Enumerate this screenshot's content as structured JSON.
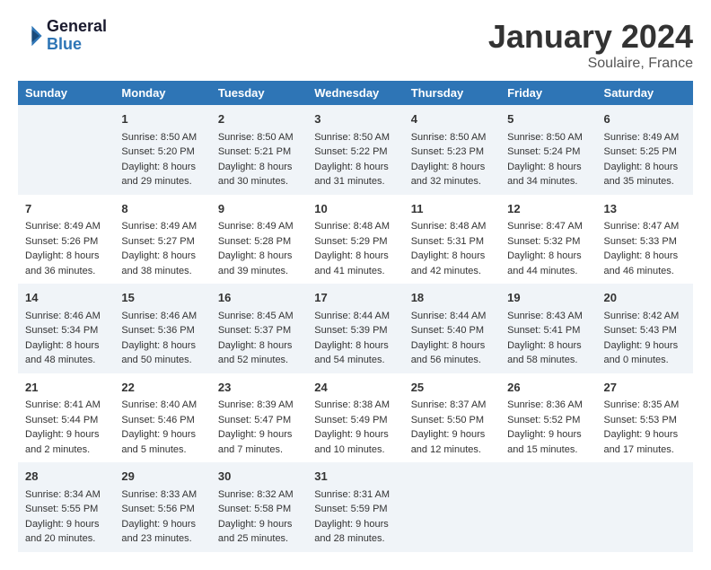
{
  "header": {
    "logo_general": "General",
    "logo_blue": "Blue",
    "month_title": "January 2024",
    "location": "Soulaire, France"
  },
  "days_of_week": [
    "Sunday",
    "Monday",
    "Tuesday",
    "Wednesday",
    "Thursday",
    "Friday",
    "Saturday"
  ],
  "weeks": [
    [
      {
        "day": "",
        "sunrise": "",
        "sunset": "",
        "daylight": ""
      },
      {
        "day": "1",
        "sunrise": "Sunrise: 8:50 AM",
        "sunset": "Sunset: 5:20 PM",
        "daylight": "Daylight: 8 hours and 29 minutes."
      },
      {
        "day": "2",
        "sunrise": "Sunrise: 8:50 AM",
        "sunset": "Sunset: 5:21 PM",
        "daylight": "Daylight: 8 hours and 30 minutes."
      },
      {
        "day": "3",
        "sunrise": "Sunrise: 8:50 AM",
        "sunset": "Sunset: 5:22 PM",
        "daylight": "Daylight: 8 hours and 31 minutes."
      },
      {
        "day": "4",
        "sunrise": "Sunrise: 8:50 AM",
        "sunset": "Sunset: 5:23 PM",
        "daylight": "Daylight: 8 hours and 32 minutes."
      },
      {
        "day": "5",
        "sunrise": "Sunrise: 8:50 AM",
        "sunset": "Sunset: 5:24 PM",
        "daylight": "Daylight: 8 hours and 34 minutes."
      },
      {
        "day": "6",
        "sunrise": "Sunrise: 8:49 AM",
        "sunset": "Sunset: 5:25 PM",
        "daylight": "Daylight: 8 hours and 35 minutes."
      }
    ],
    [
      {
        "day": "7",
        "sunrise": "Sunrise: 8:49 AM",
        "sunset": "Sunset: 5:26 PM",
        "daylight": "Daylight: 8 hours and 36 minutes."
      },
      {
        "day": "8",
        "sunrise": "Sunrise: 8:49 AM",
        "sunset": "Sunset: 5:27 PM",
        "daylight": "Daylight: 8 hours and 38 minutes."
      },
      {
        "day": "9",
        "sunrise": "Sunrise: 8:49 AM",
        "sunset": "Sunset: 5:28 PM",
        "daylight": "Daylight: 8 hours and 39 minutes."
      },
      {
        "day": "10",
        "sunrise": "Sunrise: 8:48 AM",
        "sunset": "Sunset: 5:29 PM",
        "daylight": "Daylight: 8 hours and 41 minutes."
      },
      {
        "day": "11",
        "sunrise": "Sunrise: 8:48 AM",
        "sunset": "Sunset: 5:31 PM",
        "daylight": "Daylight: 8 hours and 42 minutes."
      },
      {
        "day": "12",
        "sunrise": "Sunrise: 8:47 AM",
        "sunset": "Sunset: 5:32 PM",
        "daylight": "Daylight: 8 hours and 44 minutes."
      },
      {
        "day": "13",
        "sunrise": "Sunrise: 8:47 AM",
        "sunset": "Sunset: 5:33 PM",
        "daylight": "Daylight: 8 hours and 46 minutes."
      }
    ],
    [
      {
        "day": "14",
        "sunrise": "Sunrise: 8:46 AM",
        "sunset": "Sunset: 5:34 PM",
        "daylight": "Daylight: 8 hours and 48 minutes."
      },
      {
        "day": "15",
        "sunrise": "Sunrise: 8:46 AM",
        "sunset": "Sunset: 5:36 PM",
        "daylight": "Daylight: 8 hours and 50 minutes."
      },
      {
        "day": "16",
        "sunrise": "Sunrise: 8:45 AM",
        "sunset": "Sunset: 5:37 PM",
        "daylight": "Daylight: 8 hours and 52 minutes."
      },
      {
        "day": "17",
        "sunrise": "Sunrise: 8:44 AM",
        "sunset": "Sunset: 5:39 PM",
        "daylight": "Daylight: 8 hours and 54 minutes."
      },
      {
        "day": "18",
        "sunrise": "Sunrise: 8:44 AM",
        "sunset": "Sunset: 5:40 PM",
        "daylight": "Daylight: 8 hours and 56 minutes."
      },
      {
        "day": "19",
        "sunrise": "Sunrise: 8:43 AM",
        "sunset": "Sunset: 5:41 PM",
        "daylight": "Daylight: 8 hours and 58 minutes."
      },
      {
        "day": "20",
        "sunrise": "Sunrise: 8:42 AM",
        "sunset": "Sunset: 5:43 PM",
        "daylight": "Daylight: 9 hours and 0 minutes."
      }
    ],
    [
      {
        "day": "21",
        "sunrise": "Sunrise: 8:41 AM",
        "sunset": "Sunset: 5:44 PM",
        "daylight": "Daylight: 9 hours and 2 minutes."
      },
      {
        "day": "22",
        "sunrise": "Sunrise: 8:40 AM",
        "sunset": "Sunset: 5:46 PM",
        "daylight": "Daylight: 9 hours and 5 minutes."
      },
      {
        "day": "23",
        "sunrise": "Sunrise: 8:39 AM",
        "sunset": "Sunset: 5:47 PM",
        "daylight": "Daylight: 9 hours and 7 minutes."
      },
      {
        "day": "24",
        "sunrise": "Sunrise: 8:38 AM",
        "sunset": "Sunset: 5:49 PM",
        "daylight": "Daylight: 9 hours and 10 minutes."
      },
      {
        "day": "25",
        "sunrise": "Sunrise: 8:37 AM",
        "sunset": "Sunset: 5:50 PM",
        "daylight": "Daylight: 9 hours and 12 minutes."
      },
      {
        "day": "26",
        "sunrise": "Sunrise: 8:36 AM",
        "sunset": "Sunset: 5:52 PM",
        "daylight": "Daylight: 9 hours and 15 minutes."
      },
      {
        "day": "27",
        "sunrise": "Sunrise: 8:35 AM",
        "sunset": "Sunset: 5:53 PM",
        "daylight": "Daylight: 9 hours and 17 minutes."
      }
    ],
    [
      {
        "day": "28",
        "sunrise": "Sunrise: 8:34 AM",
        "sunset": "Sunset: 5:55 PM",
        "daylight": "Daylight: 9 hours and 20 minutes."
      },
      {
        "day": "29",
        "sunrise": "Sunrise: 8:33 AM",
        "sunset": "Sunset: 5:56 PM",
        "daylight": "Daylight: 9 hours and 23 minutes."
      },
      {
        "day": "30",
        "sunrise": "Sunrise: 8:32 AM",
        "sunset": "Sunset: 5:58 PM",
        "daylight": "Daylight: 9 hours and 25 minutes."
      },
      {
        "day": "31",
        "sunrise": "Sunrise: 8:31 AM",
        "sunset": "Sunset: 5:59 PM",
        "daylight": "Daylight: 9 hours and 28 minutes."
      },
      {
        "day": "",
        "sunrise": "",
        "sunset": "",
        "daylight": ""
      },
      {
        "day": "",
        "sunrise": "",
        "sunset": "",
        "daylight": ""
      },
      {
        "day": "",
        "sunrise": "",
        "sunset": "",
        "daylight": ""
      }
    ]
  ]
}
